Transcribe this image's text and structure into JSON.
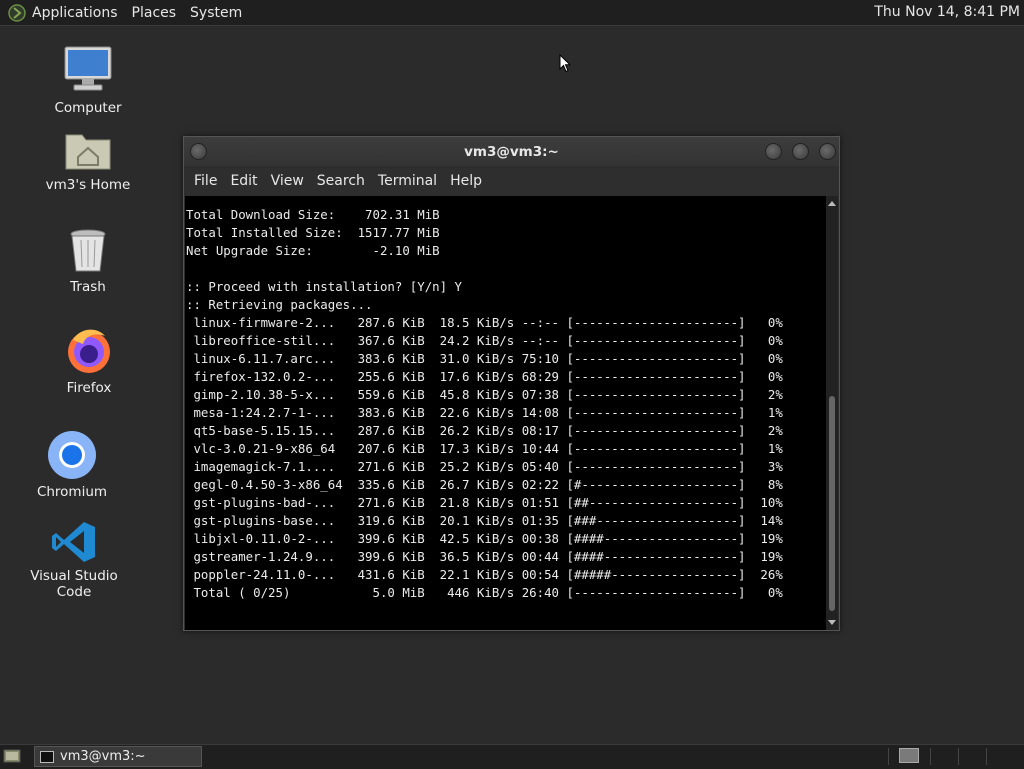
{
  "top_panel": {
    "menus": [
      "Applications",
      "Places",
      "System"
    ],
    "clock": "Thu Nov 14,  8:41 PM"
  },
  "desktop": {
    "icons": [
      {
        "label": "Computer",
        "icon": "computer-icon"
      },
      {
        "label": "vm3's Home",
        "icon": "home-folder-icon"
      },
      {
        "label": "Trash",
        "icon": "trash-icon"
      },
      {
        "label": "Firefox",
        "icon": "firefox-icon"
      },
      {
        "label": "Chromium",
        "icon": "chromium-icon"
      },
      {
        "label": "Visual Studio Code",
        "icon": "vscode-icon"
      }
    ]
  },
  "window": {
    "title": "vm3@vm3:~",
    "menu": [
      "File",
      "Edit",
      "View",
      "Search",
      "Terminal",
      "Help"
    ]
  },
  "terminal": {
    "lines": [
      "Total Download Size:    702.31 MiB",
      "Total Installed Size:  1517.77 MiB",
      "Net Upgrade Size:        -2.10 MiB",
      "",
      ":: Proceed with installation? [Y/n] Y",
      ":: Retrieving packages...",
      " linux-firmware-2...   287.6 KiB  18.5 KiB/s --:-- [----------------------]   0%",
      " libreoffice-stil...   367.6 KiB  24.2 KiB/s --:-- [----------------------]   0%",
      " linux-6.11.7.arc...   383.6 KiB  31.0 KiB/s 75:10 [----------------------]   0%",
      " firefox-132.0.2-...   255.6 KiB  17.6 KiB/s 68:29 [----------------------]   0%",
      " gimp-2.10.38-5-x...   559.6 KiB  45.8 KiB/s 07:38 [----------------------]   2%",
      " mesa-1:24.2.7-1-...   383.6 KiB  22.6 KiB/s 14:08 [----------------------]   1%",
      " qt5-base-5.15.15...   287.6 KiB  26.2 KiB/s 08:17 [----------------------]   2%",
      " vlc-3.0.21-9-x86_64   207.6 KiB  17.3 KiB/s 10:44 [----------------------]   1%",
      " imagemagick-7.1....   271.6 KiB  25.2 KiB/s 05:40 [----------------------]   3%",
      " gegl-0.4.50-3-x86_64  335.6 KiB  26.7 KiB/s 02:22 [#---------------------]   8%",
      " gst-plugins-bad-...   271.6 KiB  21.8 KiB/s 01:51 [##--------------------]  10%",
      " gst-plugins-base...   319.6 KiB  20.1 KiB/s 01:35 [###-------------------]  14%",
      " libjxl-0.11.0-2-...   399.6 KiB  42.5 KiB/s 00:38 [####------------------]  19%",
      " gstreamer-1.24.9...   399.6 KiB  36.5 KiB/s 00:44 [####------------------]  19%",
      " poppler-24.11.0-...   431.6 KiB  22.1 KiB/s 00:54 [#####-----------------]  26%",
      " Total ( 0/25)           5.0 MiB   446 KiB/s 26:40 [----------------------]   0%"
    ]
  },
  "taskbar": {
    "task_label": "vm3@vm3:~"
  },
  "colors": {
    "desktop_bg": "#2b2b2b",
    "panel_bg": "#1f1f1f",
    "terminal_bg": "#000000",
    "terminal_fg": "#ececec"
  }
}
